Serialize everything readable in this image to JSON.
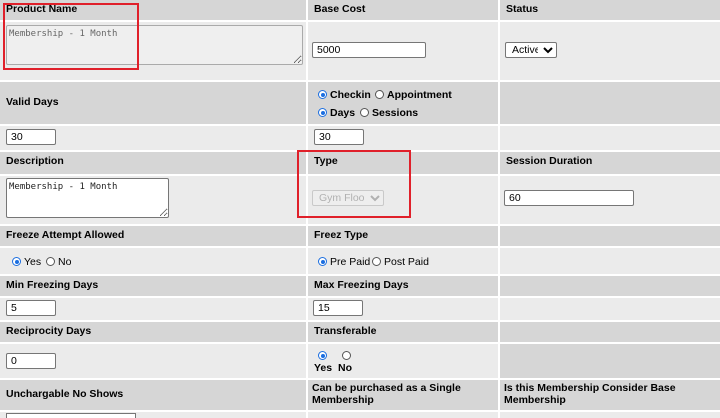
{
  "product_name": {
    "label": "Product Name",
    "value": "Membership - 1 Month"
  },
  "base_cost": {
    "label": "Base Cost",
    "value": "5000"
  },
  "status": {
    "label": "Status",
    "selected": "Active"
  },
  "valid_days": {
    "label": "Valid Days",
    "value": "30"
  },
  "checkin_mode": {
    "checkin": "Checkin",
    "appointment": "Appointment"
  },
  "unit_mode": {
    "days": "Days",
    "sessions": "Sessions",
    "value": "30"
  },
  "description": {
    "label": "Description",
    "value": "Membership - 1 Month"
  },
  "type": {
    "label": "Type",
    "selected": "Gym Floor"
  },
  "session_duration": {
    "label": "Session Duration",
    "value": "60"
  },
  "freeze_attempt": {
    "label": "Freeze Attempt Allowed",
    "yes": "Yes",
    "no": "No"
  },
  "freez_type": {
    "label": "Freez Type",
    "pre_paid": "Pre Paid",
    "post_paid": "Post Paid"
  },
  "min_freezing_days": {
    "label": "Min Freezing Days",
    "value": "5"
  },
  "max_freezing_days": {
    "label": "Max Freezing Days",
    "value": "15"
  },
  "reciprocity_days": {
    "label": "Reciprocity Days",
    "value": "0"
  },
  "transferable": {
    "label": "Transferable",
    "yes": "Yes",
    "no": "No"
  },
  "unchargable_no_shows": {
    "label": "Unchargable No Shows"
  },
  "single_membership": {
    "label_line1": "Can be purchased as a Single",
    "label_line2": "Membership"
  },
  "base_membership": {
    "label_line1": "Is this Membership Consider Base",
    "label_line2": "Membership"
  },
  "colors": {
    "header_bg": "#d6d6d6",
    "value_bg": "#ebebeb",
    "highlight": "#e0202a",
    "radio_accent": "#1b6ee0"
  }
}
